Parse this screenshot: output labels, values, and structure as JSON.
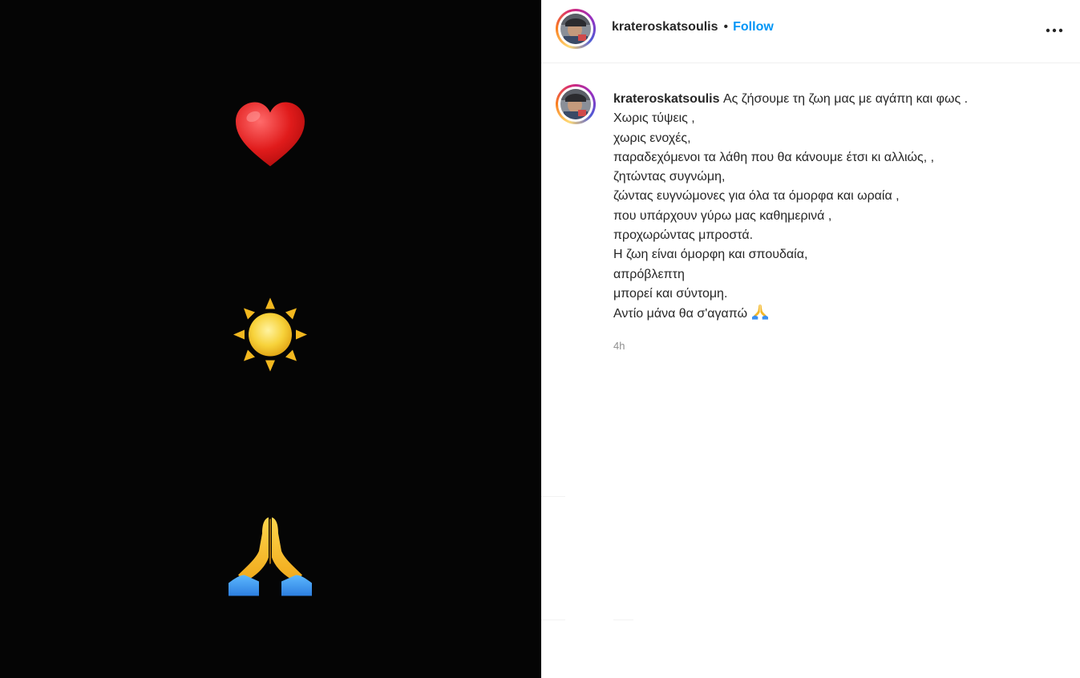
{
  "post": {
    "media": {
      "emojis": [
        {
          "name": "heart-emoji",
          "glyph": "❤️"
        },
        {
          "name": "sun-emoji",
          "glyph": "☀️"
        },
        {
          "name": "praying-hands-emoji",
          "glyph": "🙏"
        }
      ],
      "background": "#050505"
    },
    "header": {
      "username": "krateroskatsoulis",
      "separator": "•",
      "follow_label": "Follow"
    },
    "caption": {
      "username": "krateroskatsoulis",
      "lines": [
        "Ας ζήσουμε τη ζωη μας με αγάπη και φως .",
        "Χωρις τύψεις ,",
        "χωρις ενοχές,",
        "παραδεχόμενοι τα λάθη που θα κάνουμε έτσι κι αλλιώς, ,",
        "ζητώντας συγνώμη,",
        "ζώντας ευγνώμονες για όλα τα όμορφα και ωραία ,",
        "που υπάρχουν γύρω μας καθημερινά ,",
        "προχωρώντας μπροστά.",
        "Η ζωη είναι όμορφη και σπουδαία,",
        "απρόβλεπτη",
        "μπορεί και σύντομη.",
        "Αντίο μάνα θα σ'αγαπώ"
      ],
      "closing_emoji": "praying-hands",
      "timestamp": "4h"
    },
    "colors": {
      "link_blue": "#0095f6",
      "text": "#262626",
      "muted": "#8e8e8e"
    }
  }
}
